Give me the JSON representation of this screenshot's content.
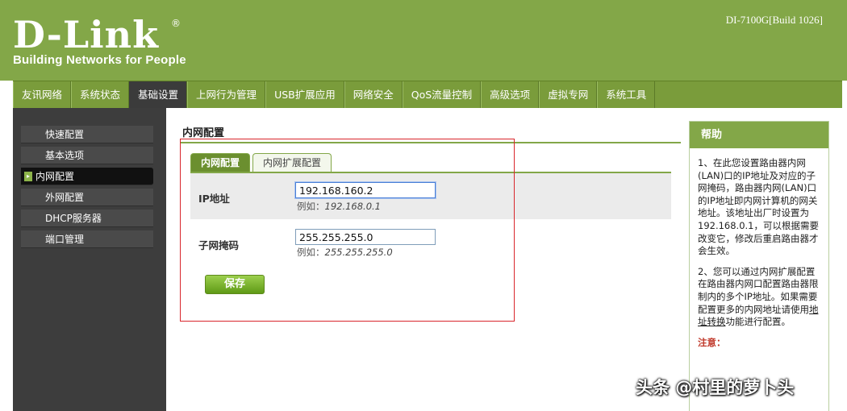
{
  "brand": {
    "name": "D-Link",
    "tagline": "Building Networks for People",
    "registered": "®"
  },
  "model": "DI-7100G[Build 1026]",
  "nav": [
    {
      "label": "友讯网络"
    },
    {
      "label": "系统状态"
    },
    {
      "label": "基础设置",
      "active": true
    },
    {
      "label": "上网行为管理"
    },
    {
      "label": "USB扩展应用"
    },
    {
      "label": "网络安全"
    },
    {
      "label": "QoS流量控制"
    },
    {
      "label": "高级选项"
    },
    {
      "label": "虚拟专网"
    },
    {
      "label": "系统工具"
    }
  ],
  "sidebar": [
    {
      "label": "快速配置"
    },
    {
      "label": "基本选项"
    },
    {
      "label": "内网配置",
      "active": true
    },
    {
      "label": "外网配置"
    },
    {
      "label": "DHCP服务器"
    },
    {
      "label": "端口管理"
    }
  ],
  "page_title": "内网配置",
  "tabs": [
    {
      "label": "内网配置",
      "active": true
    },
    {
      "label": "内网扩展配置"
    }
  ],
  "form": {
    "ip": {
      "label": "IP地址",
      "value": "192.168.160.2",
      "hint_prefix": "例如：",
      "hint_example": "192.168.0.1"
    },
    "mask": {
      "label": "子网掩码",
      "value": "255.255.255.0",
      "hint_prefix": "例如：",
      "hint_example": "255.255.255.0"
    },
    "save_label": "保存"
  },
  "help": {
    "title": "帮助",
    "p1": "1、在此您设置路由器内网(LAN)口的IP地址及对应的子网掩码，路由器内网(LAN)口的IP地址即内网计算机的网关地址。该地址出厂时设置为192.168.0.1，可以根据需要改变它，修改后重启路由器才会生效。",
    "p2_before": "2、您可以通过内网扩展配置在路由器内网口配置路由器限制内的多个IP地址。如果需要配置更多的内网地址请使用",
    "p2_link": "地址转换",
    "p2_after": "功能进行配置。",
    "note": "注意："
  },
  "watermark": "头条 @村里的萝卜头",
  "colors": {
    "brand_green": "#83a748",
    "nav_active": "#3b3b3b",
    "sidebar_bg": "#3d3d3d",
    "highlight_box": "#d9262c"
  }
}
